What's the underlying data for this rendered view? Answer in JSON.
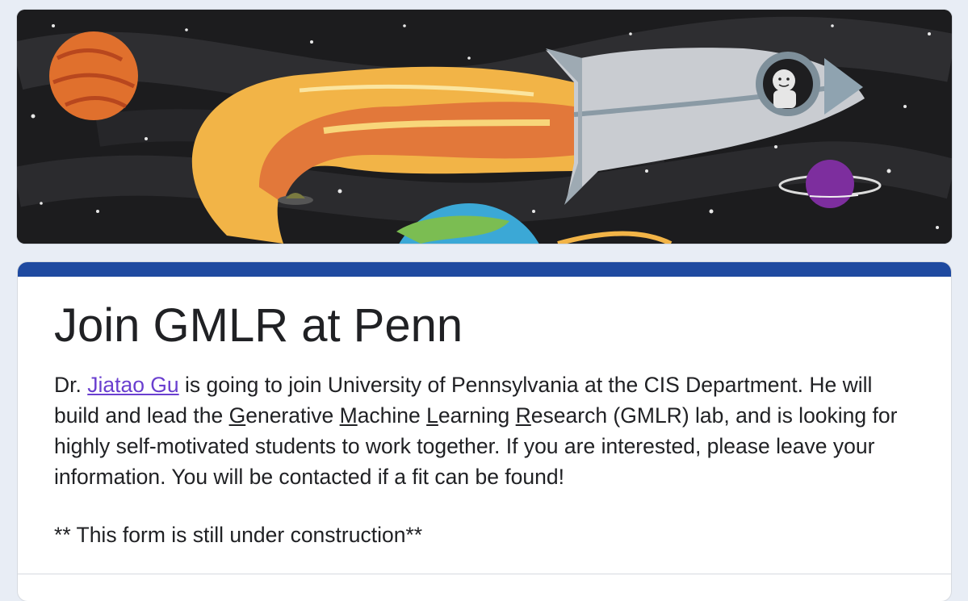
{
  "form": {
    "title": "Join GMLR at Penn",
    "description": {
      "prefix": "Dr. ",
      "link_text": "Jiatao Gu",
      "after_link": " is going to join University of Pennsylvania at the CIS Department. He will build and lead the ",
      "g_initial": "G",
      "g_rest": "enerative ",
      "m_initial": "M",
      "m_rest": "achine ",
      "l_initial": "L",
      "l_rest": "earning ",
      "r_initial": "R",
      "r_rest": "esearch (GMLR) lab, and is looking for highly self-motivated students to work together. If you are interested, please leave your information. You will be contacted if a fit can be found!"
    },
    "note": "** This form is still under construction**"
  },
  "colors": {
    "accent": "#1f4aa0",
    "link": "#6a3fcf",
    "background": "#e8edf5"
  },
  "banner": {
    "icon": "rocket-space-illustration"
  }
}
